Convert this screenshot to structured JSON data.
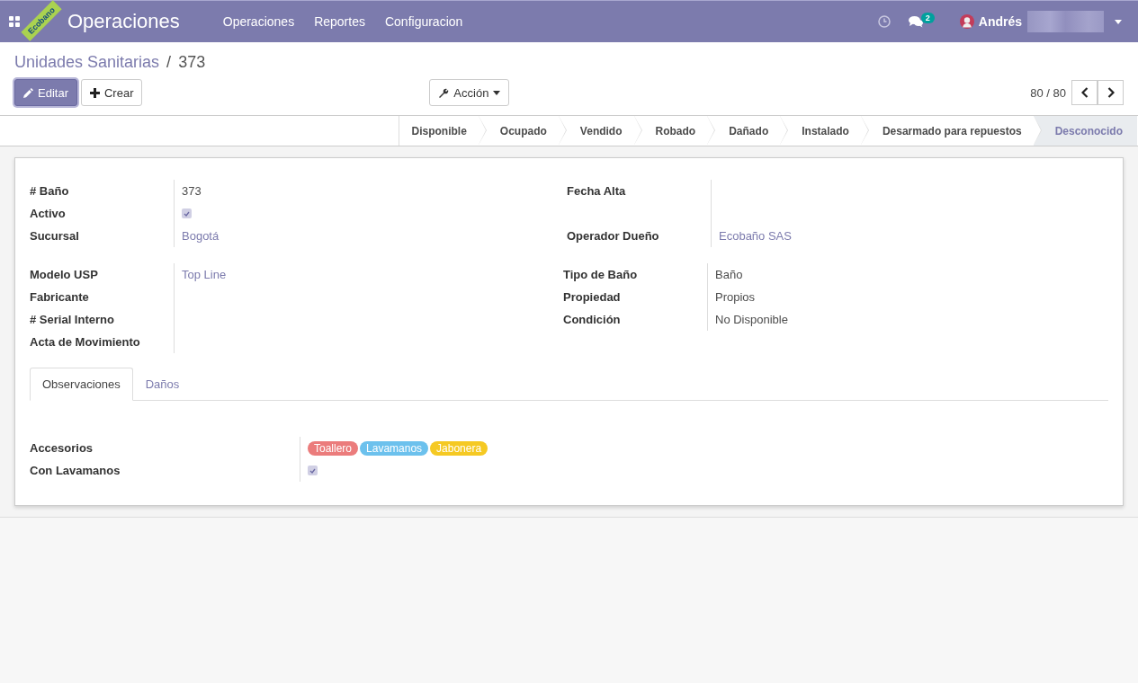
{
  "ribbon": {
    "label": "Ecobano"
  },
  "navbar": {
    "app_title": "Operaciones",
    "menus": [
      "Operaciones",
      "Reportes",
      "Configuracion"
    ],
    "message_count": "2",
    "user": "Andrés"
  },
  "breadcrumb": {
    "parent": "Unidades Sanitarias",
    "separator": "/",
    "current": "373"
  },
  "buttons": {
    "edit": "Editar",
    "create": "Crear",
    "action": "Acción"
  },
  "pager": {
    "value": "80 / 80"
  },
  "stages": [
    {
      "label": "Disponible",
      "selected": false
    },
    {
      "label": "Ocupado",
      "selected": false
    },
    {
      "label": "Vendido",
      "selected": false
    },
    {
      "label": "Robado",
      "selected": false
    },
    {
      "label": "Dañado",
      "selected": false
    },
    {
      "label": "Instalado",
      "selected": false
    },
    {
      "label": "Desarmado para repuestos",
      "selected": false
    },
    {
      "label": "Desconocido",
      "selected": true
    }
  ],
  "groups": [
    {
      "left": [
        {
          "label": "# Baño",
          "kind": "text",
          "value": "373"
        },
        {
          "label": "Activo",
          "kind": "checkbox",
          "checked": true
        },
        {
          "label": "Sucursal",
          "kind": "link",
          "value": "Bogotá"
        }
      ],
      "right": [
        {
          "label": "Fecha Alta",
          "kind": "text"
        },
        {
          "kind": "spacer"
        },
        {
          "label": "Operador Dueño",
          "kind": "link",
          "value": "Ecobaño SAS"
        }
      ]
    },
    {
      "left": [
        {
          "label": "Modelo USP",
          "kind": "link",
          "value": "Top Line"
        },
        {
          "label": "Fabricante",
          "kind": "text"
        },
        {
          "label": "# Serial Interno",
          "kind": "text"
        },
        {
          "label": "Acta de Movimiento",
          "kind": "text"
        }
      ],
      "right": [
        {
          "label": "Tipo de Baño",
          "kind": "text",
          "value": "Baño"
        },
        {
          "label": "Propiedad",
          "kind": "text",
          "value": "Propios"
        },
        {
          "label": "Condición",
          "kind": "text",
          "value": "No Disponible"
        }
      ]
    }
  ],
  "tabs": [
    {
      "label": "Observaciones",
      "selected": true
    },
    {
      "label": "Daños",
      "selected": false
    }
  ],
  "tab_fields": [
    {
      "label": "Accesorios",
      "kind": "tags",
      "tags": [
        {
          "label": "Toallero",
          "color": "#eb7c7c"
        },
        {
          "label": "Lavamanos",
          "color": "#6cc1ed"
        },
        {
          "label": "Jabonera",
          "color": "#f5c923"
        }
      ]
    },
    {
      "label": "Con Lavamanos",
      "kind": "checkbox",
      "checked": true
    }
  ]
}
